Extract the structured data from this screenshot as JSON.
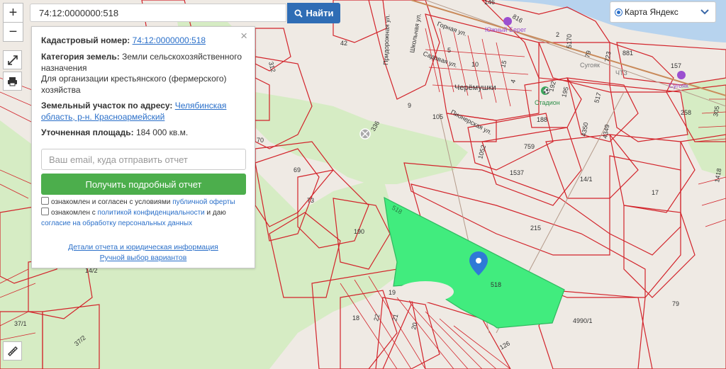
{
  "search": {
    "value": "74:12:0000000:518",
    "button_label": "Найти"
  },
  "layer_switch": {
    "label": "Карта Яндекс"
  },
  "info_panel": {
    "cadastral_label": "Кадастровый номер:",
    "cadastral_number": "74:12:0000000:518",
    "category_label": "Категория земель:",
    "category_value": "Земли сельскохозяйственного назначения",
    "usage": "Для организации крестьянского (фермерского) хозяйства",
    "address_label": "Земельный участок по адресу:",
    "address_link": "Челябинская область, р-н. Красноармейский",
    "area_label": "Уточненная площадь:",
    "area_value": "184 000 кв.м.",
    "email_placeholder": "Ваш email, куда отправить отчет",
    "report_button": "Получить подробный отчет",
    "consent1_text": "ознакомлен и согласен с условиями",
    "consent1_link": "публичной оферты",
    "consent2_text": "ознакомлен с",
    "consent2_link": "политикой конфиденциальности",
    "consent2_mid": "и даю",
    "consent2_link2": "согласие на обработку персональных данных",
    "details_link": "Детали отчета и юридическая информация",
    "manual_link": "Ручной выбор вариантов"
  },
  "map": {
    "labels": {
      "l146": "146",
      "l816": "816",
      "l2": "2",
      "l5170": "5170",
      "l79a": "79",
      "l723": "723",
      "l881": "881",
      "l157": "157",
      "l42": "42",
      "l312": "312",
      "l15": "15",
      "l4": "4",
      "l192": "192",
      "l195": "195",
      "l517": "517",
      "l4350": "4350",
      "l4349": "4349",
      "l188": "188",
      "l258": "258",
      "l1052": "1052",
      "l759": "759",
      "l1537": "1537",
      "l141": "14/1",
      "l17": "17",
      "l70": "70",
      "l69": "69",
      "l73": "73",
      "l336": "336",
      "l190": "190",
      "l215": "215",
      "l142": "14/2",
      "l518": "518",
      "l518b": "518",
      "l19": "19",
      "l18": "18",
      "l22": "22",
      "l21": "21",
      "l20": "20",
      "l126": "126",
      "l49901": "4990/1",
      "l79b": "79",
      "l371": "37/1",
      "l372": "37/2",
      "l1418": "1418",
      "l305": "305",
      "l5": "5",
      "l10": "10",
      "l9": "9",
      "l105": "105"
    },
    "streets": {
      "pridoroznaya": "Придорожная ул.",
      "shkolnaya": "Школьная ул.",
      "sadovaya": "Садовая ул.",
      "pionerskaya": "Пионерская ул.",
      "gornaya": "Горная ул."
    },
    "places": {
      "cheryomushki": "Черёмушки",
      "stadion": "Стадион",
      "yuzhny_bereg": "Южный Берег",
      "sugoyak": "Сугояк",
      "sugoyak2": "Сугояк",
      "chtz": "ЧТЗ"
    },
    "colors": {
      "parcel_line": "#d2232a",
      "selected_parcel": "#41ec7e",
      "forest": "#d6ecc4",
      "water": "#b7d3ee",
      "background": "#efeae4"
    }
  }
}
